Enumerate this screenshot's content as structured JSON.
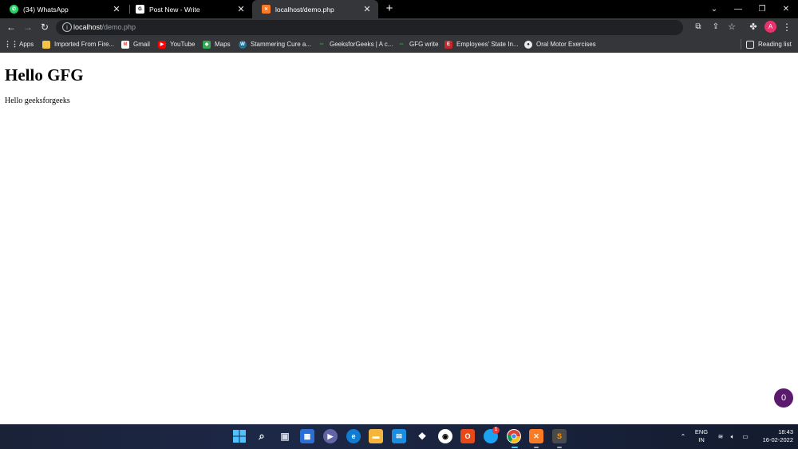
{
  "browser": {
    "tabs": [
      {
        "title": "(34) WhatsApp",
        "favicon": "whatsapp-icon",
        "color": "#25d366"
      },
      {
        "title": "Post New - Write",
        "favicon": "gfg-write-icon",
        "color": "#ffffff"
      },
      {
        "title": "localhost/demo.php",
        "favicon": "xampp-icon",
        "color": "#fb7a24"
      }
    ],
    "new_tab_symbol": "+",
    "address": {
      "host": "localhost",
      "path": "/demo.php"
    },
    "profile_initial": "A"
  },
  "bookmarks": {
    "items": [
      {
        "label": "Apps",
        "icon": "apps-grid-icon"
      },
      {
        "label": "Imported From Fire...",
        "icon": "folder-icon"
      },
      {
        "label": "Gmail",
        "icon": "gmail-icon"
      },
      {
        "label": "YouTube",
        "icon": "youtube-icon"
      },
      {
        "label": "Maps",
        "icon": "maps-icon"
      },
      {
        "label": "Stammering Cure a...",
        "icon": "wordpress-icon"
      },
      {
        "label": "GeeksforGeeks | A c...",
        "icon": "gfg-icon"
      },
      {
        "label": "GFG write",
        "icon": "gfg-icon"
      },
      {
        "label": "Employees' State In...",
        "icon": "esic-icon"
      },
      {
        "label": "Oral Motor Exercises",
        "icon": "globe-icon"
      }
    ],
    "reading_list": "Reading list"
  },
  "page": {
    "heading": "Hello GFG",
    "text": "Hello geeksforgeeks",
    "badge_count": "0"
  },
  "taskbar": {
    "lang_line1": "ENG",
    "lang_line2": "IN",
    "time": "18:43",
    "date": "16-02-2022",
    "notification_count": "1"
  },
  "colors": {
    "tab_strip_bg": "#000000",
    "toolbar_bg": "#35363a",
    "omnibox_bg": "#202124",
    "profile_accent": "#e8336d",
    "badge_accent": "#5c1a6e"
  }
}
